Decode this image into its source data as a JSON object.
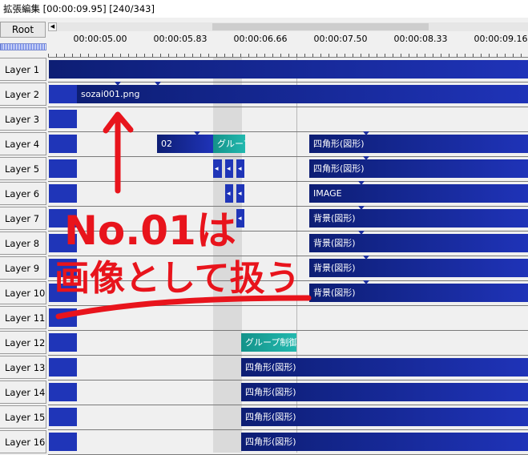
{
  "window": {
    "title": "拡張編集 [00:00:09.95] [240/343]"
  },
  "root_button": "Root",
  "ruler": {
    "ticks": [
      "00:00:05.00",
      "00:00:05.83",
      "00:00:06.66",
      "00:00:07.50",
      "00:00:08.33",
      "00:00:09.16"
    ]
  },
  "layers": [
    "Layer 1",
    "Layer 2",
    "Layer 3",
    "Layer 4",
    "Layer 5",
    "Layer 6",
    "Layer 7",
    "Layer 8",
    "Layer 9",
    "Layer 10",
    "Layer 11",
    "Layer 12",
    "Layer 13",
    "Layer 14",
    "Layer 15",
    "Layer 16"
  ],
  "clips": {
    "l2_sozai": "sozai001.png",
    "l4_02": "02",
    "l4_group": "グループ",
    "l4_rect": "四角形(図形)",
    "l5_rect": "四角形(図形)",
    "l6_image": "IMAGE",
    "l7_bg": "背景(図形)",
    "l8_bg": "背景(図形)",
    "l9_bg": "背景(図形)",
    "l10_bg": "背景(図形)",
    "l12_group": "グループ制御",
    "l13_rect": "四角形(図形)",
    "l14_rect": "四角形(図形)",
    "l15_rect": "四角形(図形)",
    "l16_rect": "四角形(図形)"
  },
  "annotation": {
    "line1": "No.01は",
    "line2": "画像として扱う",
    "color": "#e8141c"
  },
  "colors": {
    "clip_dark": "#0d1e74",
    "clip_light": "#1f33b8",
    "group": "#1aa79d"
  }
}
